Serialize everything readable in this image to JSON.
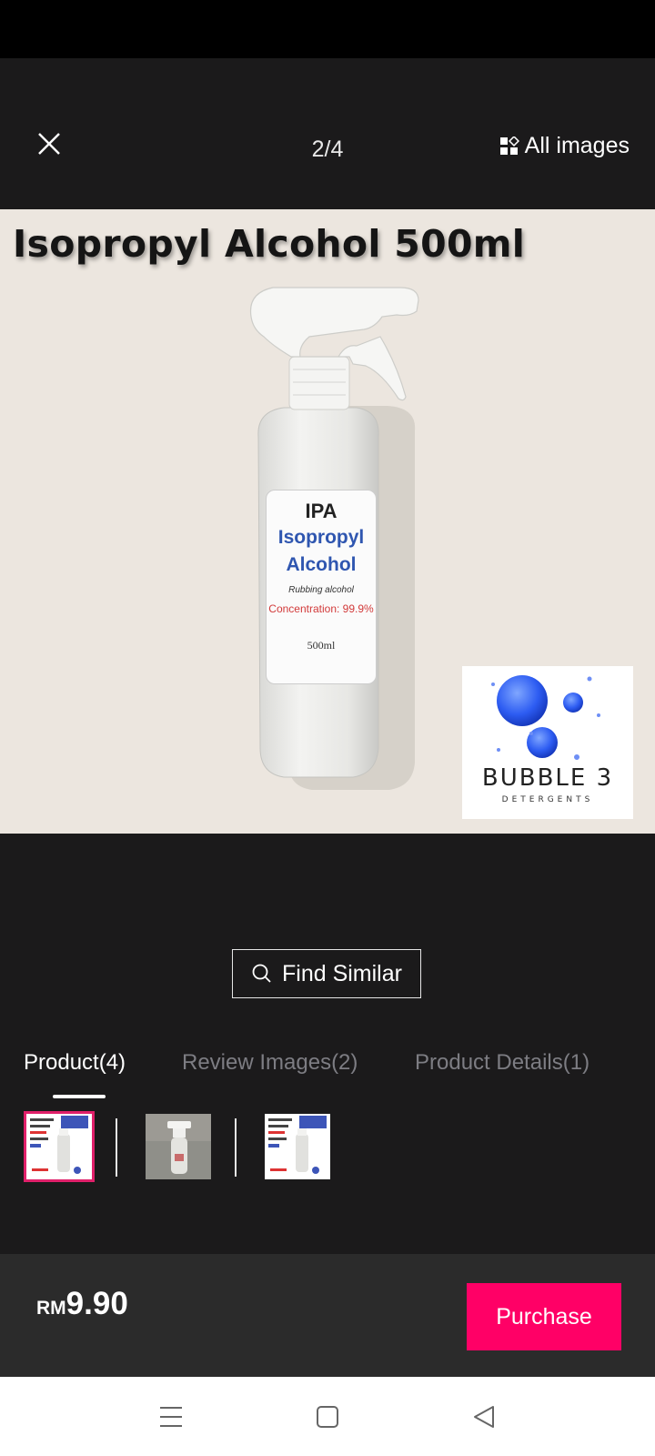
{
  "viewer": {
    "counter": "2/4",
    "all_images_label": "All images"
  },
  "photo": {
    "title": "Isopropyl Alcohol 500ml",
    "label": {
      "line1": "IPA",
      "line2": "Isopropyl",
      "line3": "Alcohol",
      "subtitle": "Rubbing alcohol",
      "concentration": "Concentration: 99.9%",
      "volume": "500ml"
    },
    "logo": {
      "name": "BUBBLE 3",
      "sub": "DETERGENTS"
    }
  },
  "find_similar_label": "Find Similar",
  "tabs": [
    {
      "label": "Product(4)",
      "active": true
    },
    {
      "label": "Review Images(2)",
      "active": false
    },
    {
      "label": "Product Details(1)",
      "active": false
    }
  ],
  "thumbnails": {
    "selected_index": 0
  },
  "purchase_bar": {
    "currency": "RM",
    "price": "9.90",
    "button_label": "Purchase"
  },
  "colors": {
    "accent": "#ff0066",
    "background": "#1b1a1b",
    "bottom_bar": "#2b2b2b"
  },
  "icons": [
    "close-icon",
    "grid-icon",
    "search-icon",
    "menu-icon",
    "home-square-icon",
    "back-triangle-icon"
  ]
}
